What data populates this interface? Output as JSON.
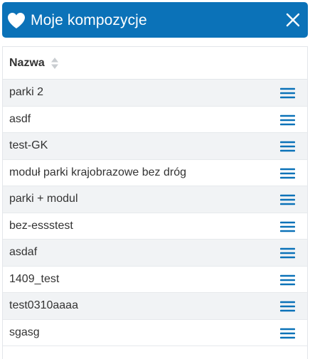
{
  "header": {
    "title": "Moje kompozycje",
    "heart_icon": "heart-icon",
    "close_icon": "close-icon",
    "background_color": "#0b72b8"
  },
  "table": {
    "column_header": "Nazwa",
    "sort_icon": "sort-icon",
    "row_action_icon": "menu-icon",
    "accent_color": "#0b72b8",
    "rows": [
      {
        "label": "parki 2"
      },
      {
        "label": "asdf"
      },
      {
        "label": "test-GK"
      },
      {
        "label": "moduł parki krajobrazowe bez dróg"
      },
      {
        "label": "parki + modul"
      },
      {
        "label": "bez-essstest"
      },
      {
        "label": "asdaf"
      },
      {
        "label": "1409_test"
      },
      {
        "label": "test0310aaaa"
      },
      {
        "label": "sgasg"
      }
    ]
  }
}
